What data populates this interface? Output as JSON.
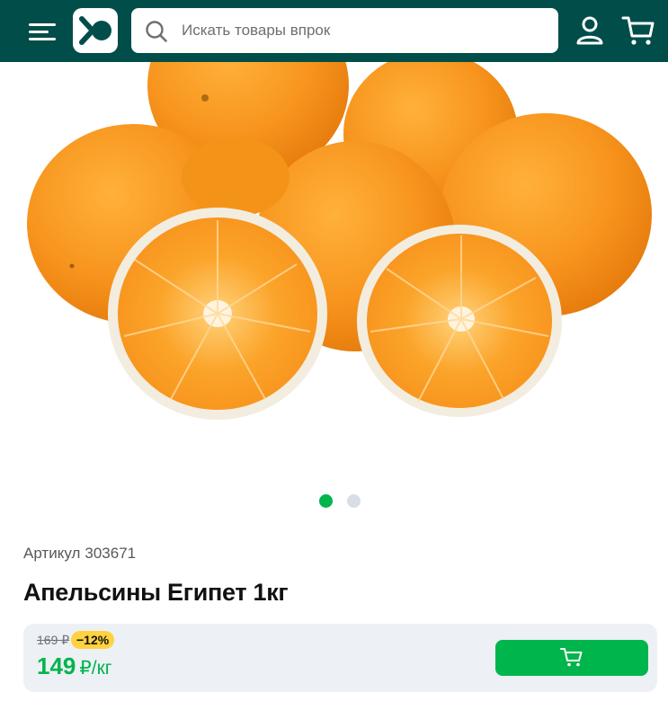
{
  "header": {
    "menu_icon": "hamburger-menu-icon",
    "logo_icon": "brand-logo",
    "search": {
      "placeholder": "Искать товары впрок",
      "value": ""
    },
    "user_icon": "user-icon",
    "cart_icon": "cart-icon",
    "background_color": "#004d4a"
  },
  "product": {
    "image_alt": "oranges",
    "carousel": {
      "total": 2,
      "active_index": 0
    },
    "sku_label": "Артикул",
    "sku_number": "303671",
    "title": "Апельсины Египет 1кг"
  },
  "price": {
    "old_price": "169 ₽",
    "discount": "−12%",
    "new_price": "149",
    "unit": "₽/кг",
    "accent_color": "#00b54b",
    "discount_color": "#ffd23f"
  },
  "actions": {
    "add_to_cart_icon": "cart-icon"
  }
}
